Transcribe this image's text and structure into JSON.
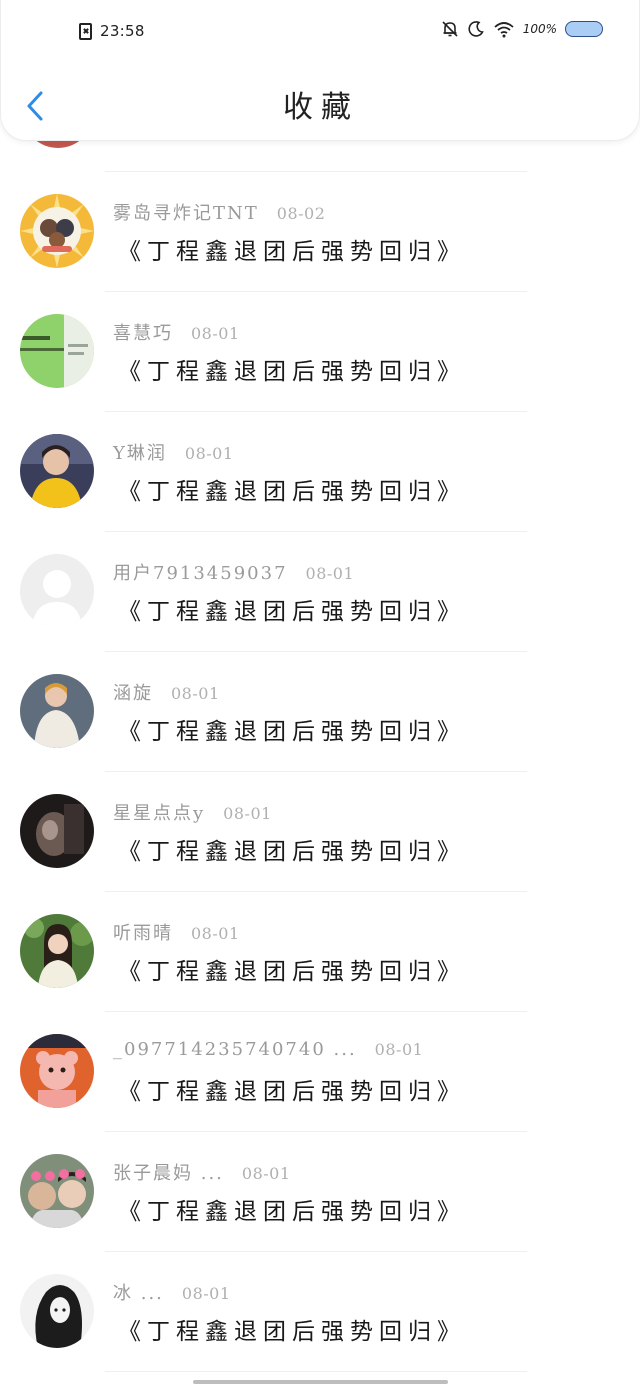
{
  "status_bar": {
    "time": "23:58",
    "battery": "100%",
    "icons": [
      "sim-icon",
      "mute-bell-icon",
      "moon-icon",
      "wifi-icon",
      "battery-icon"
    ]
  },
  "header": {
    "title": "收藏",
    "back_icon": "chevron-left-icon"
  },
  "colors": {
    "back_icon": "#2f8ce6",
    "battery_fill": "#a9cdf5",
    "meta_text": "#9b9b9b",
    "content_text": "#1a1a1a"
  },
  "items": [
    {
      "username": "雾岛寻炸记TNT",
      "date": "08-02",
      "content": "《丁程鑫退团后强势回归》"
    },
    {
      "username": "喜慧巧",
      "date": "08-01",
      "content": "《丁程鑫退团后强势回归》"
    },
    {
      "username": "Y琳润",
      "date": "08-01",
      "content": "《丁程鑫退团后强势回归》"
    },
    {
      "username": "用户7913459037",
      "date": "08-01",
      "content": "《丁程鑫退团后强势回归》"
    },
    {
      "username": "涵旋",
      "date": "08-01",
      "content": "《丁程鑫退团后强势回归》"
    },
    {
      "username": "星星点点y",
      "date": "08-01",
      "content": "《丁程鑫退团后强势回归》"
    },
    {
      "username": "听雨晴",
      "date": "08-01",
      "content": "《丁程鑫退团后强势回归》"
    },
    {
      "username": "_097714235740740 ...",
      "date": "08-01",
      "content": "《丁程鑫退团后强势回归》"
    },
    {
      "username": "张子晨妈 ...",
      "date": "08-01",
      "content": "《丁程鑫退团后强势回归》"
    },
    {
      "username": "冰 ...",
      "date": "08-01",
      "content": "《丁程鑫退团后强势回归》"
    }
  ]
}
